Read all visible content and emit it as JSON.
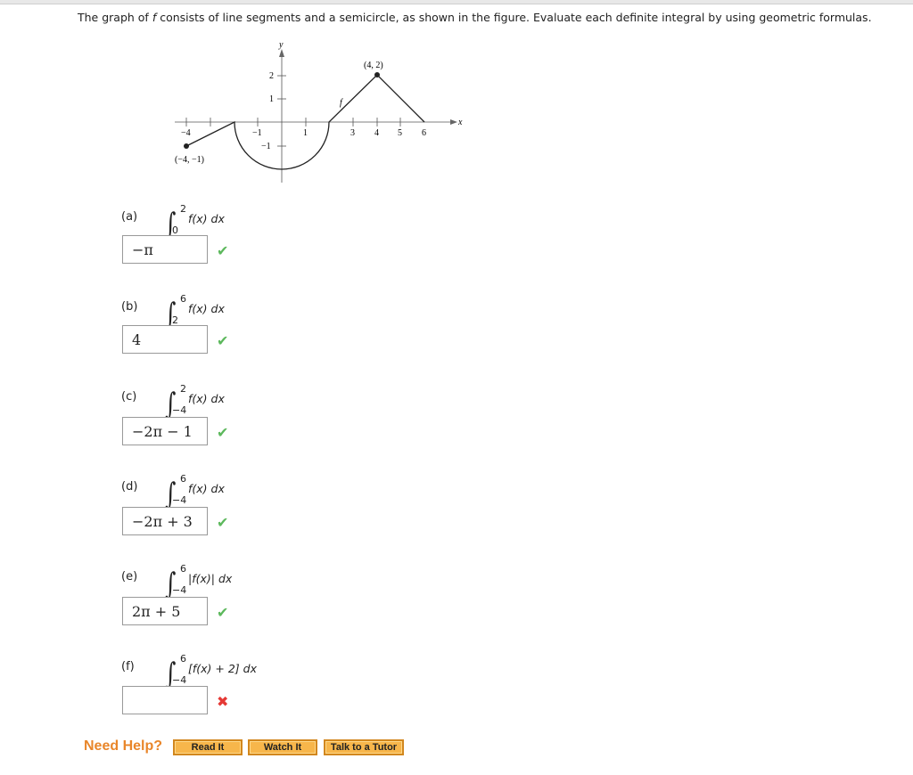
{
  "prompt": {
    "pre": "The graph of ",
    "f": "f",
    "post": " consists of line segments and a semicircle, as shown in the figure. Evaluate each definite integral by using geometric formulas."
  },
  "figure": {
    "y_axis_label": "y",
    "x_axis_label": "x",
    "function_label": "f",
    "point_left": "(−4, −1)",
    "point_peak": "(4, 2)",
    "x_ticks": [
      "−4",
      "−1",
      "1",
      "3",
      "4",
      "5",
      "6"
    ],
    "y_ticks": [
      "2",
      "1",
      "−1"
    ]
  },
  "parts": [
    {
      "label": "(a)",
      "lower": "0",
      "upper": "2",
      "integrand": "f(x) dx",
      "answer": "−π",
      "status": "correct"
    },
    {
      "label": "(b)",
      "lower": "2",
      "upper": "6",
      "integrand": "f(x) dx",
      "answer": "4",
      "status": "correct"
    },
    {
      "label": "(c)",
      "lower": "−4",
      "upper": "2",
      "integrand": "f(x) dx",
      "answer": "−2π − 1",
      "status": "correct"
    },
    {
      "label": "(d)",
      "lower": "−4",
      "upper": "6",
      "integrand": "f(x) dx",
      "answer": "−2π + 3",
      "status": "correct"
    },
    {
      "label": "(e)",
      "lower": "−4",
      "upper": "6",
      "integrand": "|f(x)| dx",
      "answer": "2π + 5",
      "status": "correct"
    },
    {
      "label": "(f)",
      "lower": "−4",
      "upper": "6",
      "integrand": "[f(x) + 2] dx",
      "answer": "",
      "status": "incorrect"
    }
  ],
  "icons": {
    "correct": "✔",
    "incorrect": "✖"
  },
  "help": {
    "label": "Need Help?",
    "buttons": [
      "Read It",
      "Watch It",
      "Talk to a Tutor"
    ]
  }
}
